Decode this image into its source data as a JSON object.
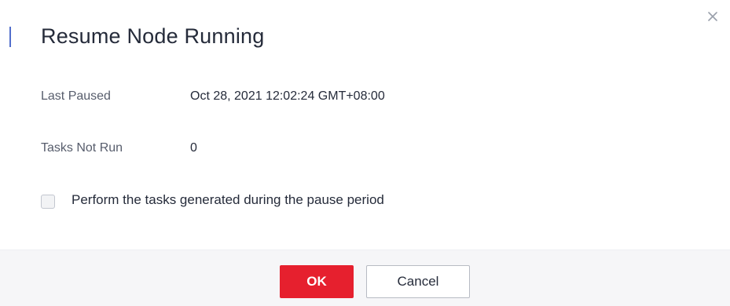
{
  "dialog": {
    "title": "Resume Node Running",
    "close_icon": "close-icon",
    "accent_color": "#526ecc"
  },
  "details": {
    "last_paused_label": "Last Paused",
    "last_paused_value": "Oct 28, 2021 12:02:24 GMT+08:00",
    "tasks_not_run_label": "Tasks Not Run",
    "tasks_not_run_value": "0"
  },
  "option": {
    "checkbox_label": "Perform the tasks generated during the pause period",
    "checked": false
  },
  "footer": {
    "ok_label": "OK",
    "cancel_label": "Cancel",
    "ok_color": "#e6202e"
  }
}
